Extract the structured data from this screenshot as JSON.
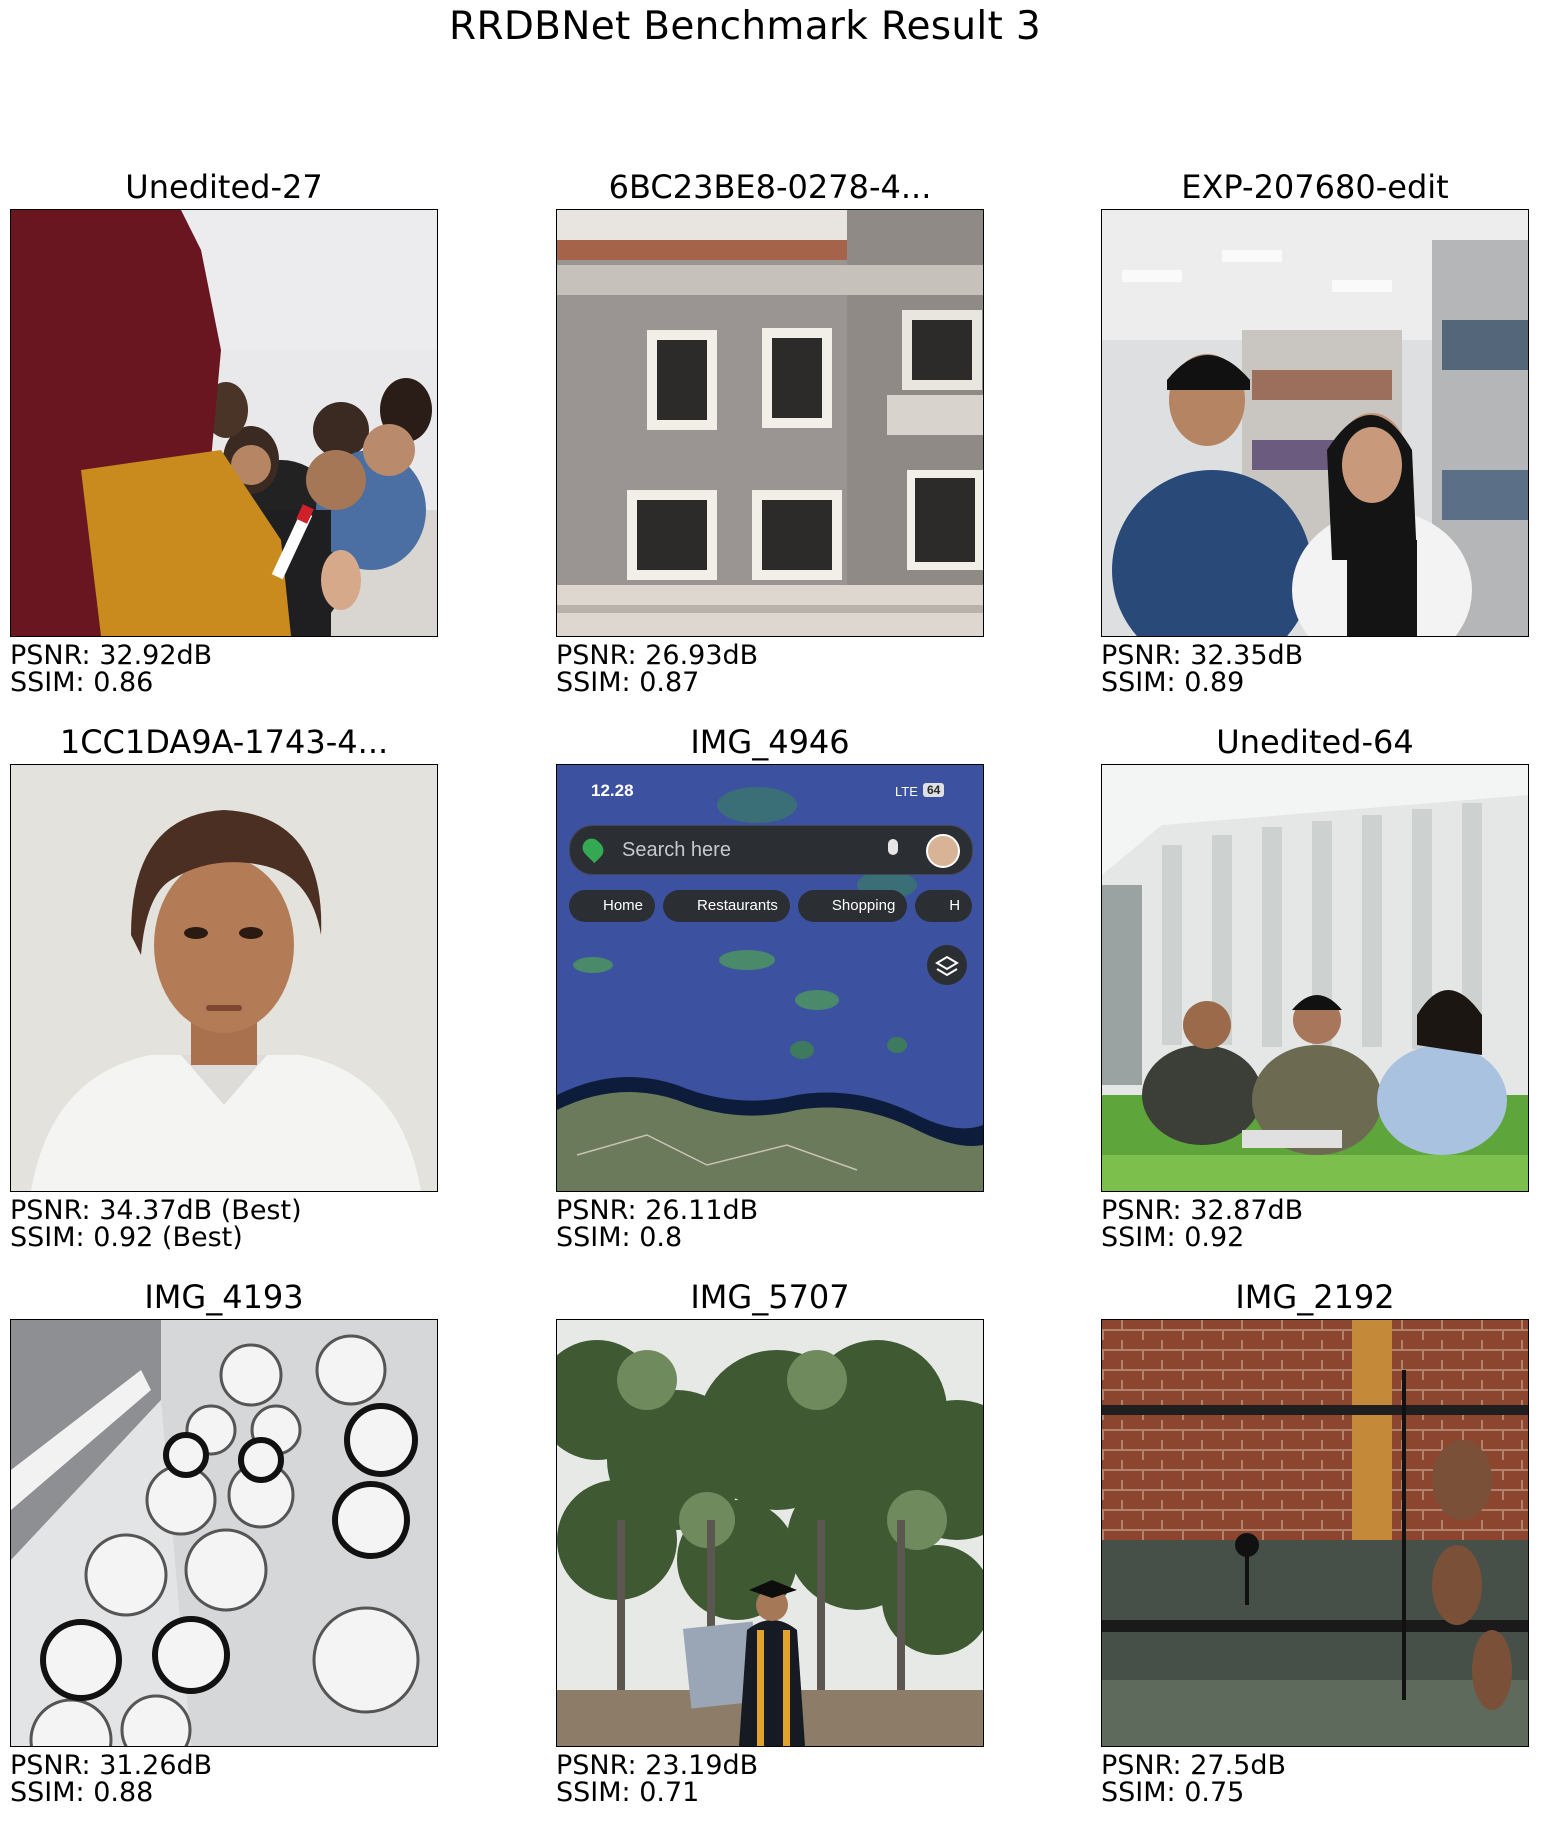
{
  "title": "RRDBNet Benchmark Result 3",
  "panels": [
    {
      "name": "Unedited-27",
      "psnr": "PSNR: 32.92dB",
      "ssim": "SSIM: 0.86"
    },
    {
      "name": "6BC23BE8-0278-4...",
      "psnr": "PSNR: 26.93dB",
      "ssim": "SSIM: 0.87"
    },
    {
      "name": "EXP-207680-edit",
      "psnr": "PSNR: 32.35dB",
      "ssim": "SSIM: 0.89"
    },
    {
      "name": "1CC1DA9A-1743-4...",
      "psnr": "PSNR: 34.37dB (Best)",
      "ssim": "SSIM: 0.92 (Best)"
    },
    {
      "name": "IMG_4946",
      "psnr": "PSNR: 26.11dB",
      "ssim": "SSIM: 0.8"
    },
    {
      "name": "Unedited-64",
      "psnr": "PSNR: 32.87dB",
      "ssim": "SSIM: 0.92"
    },
    {
      "name": "IMG_4193",
      "psnr": "PSNR: 31.26dB",
      "ssim": "SSIM: 0.88"
    },
    {
      "name": "IMG_5707",
      "psnr": "PSNR: 23.19dB",
      "ssim": "SSIM: 0.71"
    },
    {
      "name": "IMG_2192",
      "psnr": "PSNR: 27.5dB",
      "ssim": "SSIM: 0.75"
    }
  ],
  "map_screenshot": {
    "time": "12.28",
    "network": "LTE",
    "battery": "64",
    "search_placeholder": "Search here",
    "chips": [
      "Home",
      "Restaurants",
      "Shopping",
      "H"
    ]
  }
}
